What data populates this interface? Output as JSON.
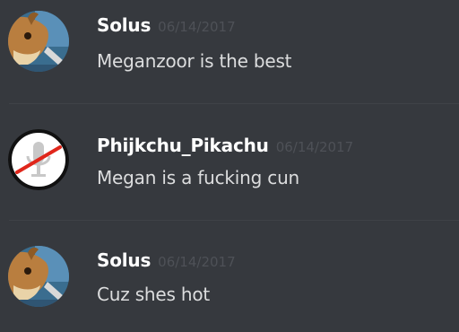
{
  "messages": [
    {
      "author": "Solus",
      "timestamp": "06/14/2017",
      "content": "Meganzoor is the best",
      "avatar_icon": "eevee-avatar-icon"
    },
    {
      "author": "Phijkchu_Pikachu",
      "timestamp": "06/14/2017",
      "content": "Megan is a fucking cun",
      "avatar_icon": "muted-microphone-avatar-icon"
    },
    {
      "author": "Solus",
      "timestamp": "06/14/2017",
      "content": "Cuz shes hot",
      "avatar_icon": "eevee-avatar-icon"
    }
  ],
  "colors": {
    "background": "#36393e",
    "author": "#ffffff",
    "timestamp": "#4e5157",
    "content": "#dcddde",
    "divider": "#3f4247",
    "mute_slash": "#e0261b"
  }
}
